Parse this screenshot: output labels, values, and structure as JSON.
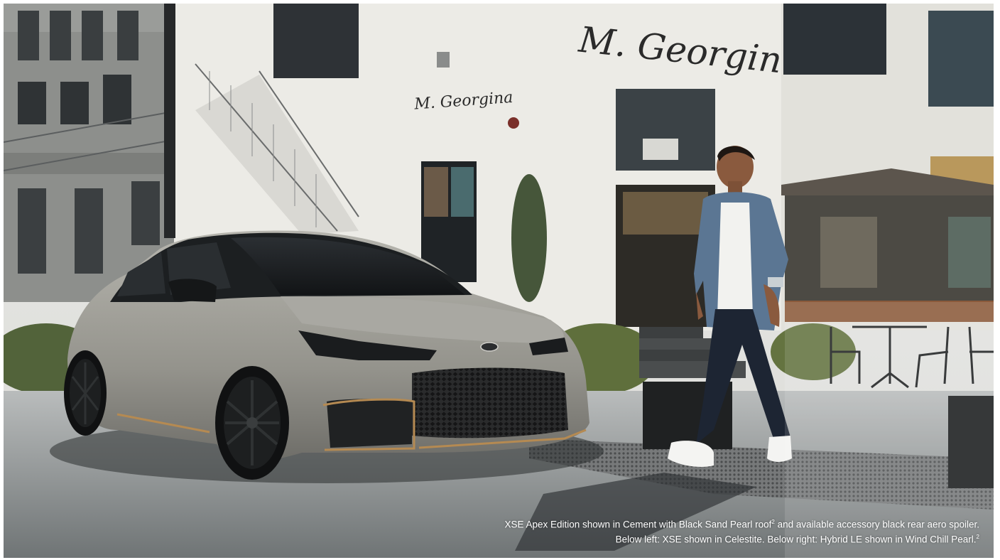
{
  "hero": {
    "wall_sign_large": "M. Georgina",
    "wall_sign_small": "M. Georgina",
    "caption": {
      "line1": "XSE Apex Edition shown in Cement with Black Sand Pearl roof",
      "line1_footnote": "2",
      "line1_tail": " and available accessory black rear aero spoiler.",
      "line2": "Below left: XSE shown in Celestite. Below right: Hybrid LE shown in Wind Chill Pearl.",
      "line2_footnote": "2"
    }
  },
  "colors": {
    "car_body": "#9c9b94",
    "trim_accent": "#b58a52",
    "caption_text": "#ffffff"
  }
}
